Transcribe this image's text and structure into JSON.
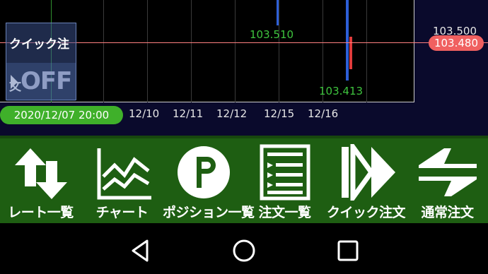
{
  "chart": {
    "price_labels": {
      "low": "103.413",
      "high": "103.510"
    },
    "axis_price": "103.500",
    "current_price": "103.480",
    "current_date": "2020/12/07 20:00",
    "date_ticks": [
      "12/10",
      "12/11",
      "12/12",
      "12/15",
      "12/16"
    ],
    "colors": {
      "up": "#2d5fd8",
      "down": "#e03b3b",
      "price_line": "#ff8080",
      "badge": "#f06060"
    }
  },
  "quick_order": {
    "label": "クイック注文",
    "state": "OFF"
  },
  "toolbar": {
    "items": [
      {
        "label": "レート一覧",
        "icon": "up-down-arrows-icon"
      },
      {
        "label": "チャート",
        "icon": "line-chart-icon"
      },
      {
        "label": "ポジション一覧",
        "icon": "p-circle-icon"
      },
      {
        "label": "注文一覧",
        "icon": "order-list-icon"
      },
      {
        "label": "クイック注文",
        "icon": "fast-forward-icon"
      },
      {
        "label": "通常注文",
        "icon": "exchange-arrows-icon"
      }
    ]
  },
  "navbar": {
    "buttons": [
      "back-icon",
      "home-icon",
      "recents-icon"
    ]
  }
}
